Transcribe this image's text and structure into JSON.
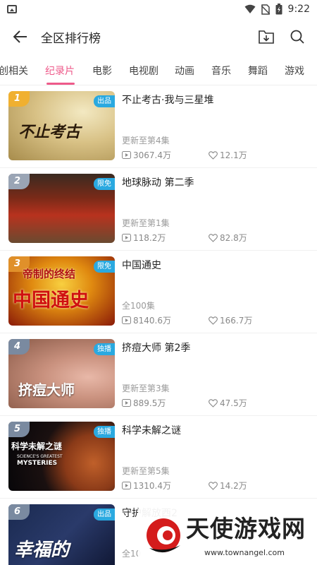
{
  "status_bar": {
    "time": "9:22",
    "icons": [
      "image-icon",
      "wifi-icon",
      "no-sim-icon",
      "battery-icon"
    ]
  },
  "header": {
    "title": "全区排行榜",
    "icons": [
      "back-arrow-icon",
      "download-icon",
      "search-icon"
    ]
  },
  "tabs": [
    {
      "label": "创相关"
    },
    {
      "label": "纪录片"
    },
    {
      "label": "电影"
    },
    {
      "label": "电视剧"
    },
    {
      "label": "动画"
    },
    {
      "label": "音乐"
    },
    {
      "label": "舞蹈"
    },
    {
      "label": "游戏"
    }
  ],
  "active_tab": "纪录片",
  "colors": {
    "accent": "#ee5a8a",
    "badge": "#2aa9e0"
  },
  "items": [
    {
      "rank": "1",
      "badge": "出品",
      "title": "不止考古·我与三星堆",
      "update": "更新至第4集",
      "views": "3067.4万",
      "likes": "12.1万",
      "thumb_text": "不止考古"
    },
    {
      "rank": "2",
      "badge": "限免",
      "title": "地球脉动 第二季",
      "update": "更新至第1集",
      "views": "118.2万",
      "likes": "82.8万",
      "thumb_text": ""
    },
    {
      "rank": "3",
      "badge": "限免",
      "title": "中国通史",
      "update": "全100集",
      "views": "8140.6万",
      "likes": "166.7万",
      "thumb_text": "中国通史",
      "thumb_text2": "帝制的终结"
    },
    {
      "rank": "4",
      "badge": "独播",
      "title": "挤痘大师 第2季",
      "update": "更新至第3集",
      "views": "889.5万",
      "likes": "47.5万",
      "thumb_text": "挤痘大师"
    },
    {
      "rank": "5",
      "badge": "独播",
      "title": "科学未解之谜",
      "update": "更新至第5集",
      "views": "1310.4万",
      "likes": "14.2万",
      "thumb_text": "科学未解之谜",
      "thumb_text2": "SCIENCE'S GREATEST",
      "thumb_text3": "MYSTERIES"
    },
    {
      "rank": "6",
      "badge": "出品",
      "title": "守护解放西2",
      "update": "全10",
      "views": "",
      "likes": "",
      "thumb_text": "幸福的"
    }
  ],
  "watermark": {
    "text": "天使游戏网",
    "url": "www.townangel.com"
  }
}
